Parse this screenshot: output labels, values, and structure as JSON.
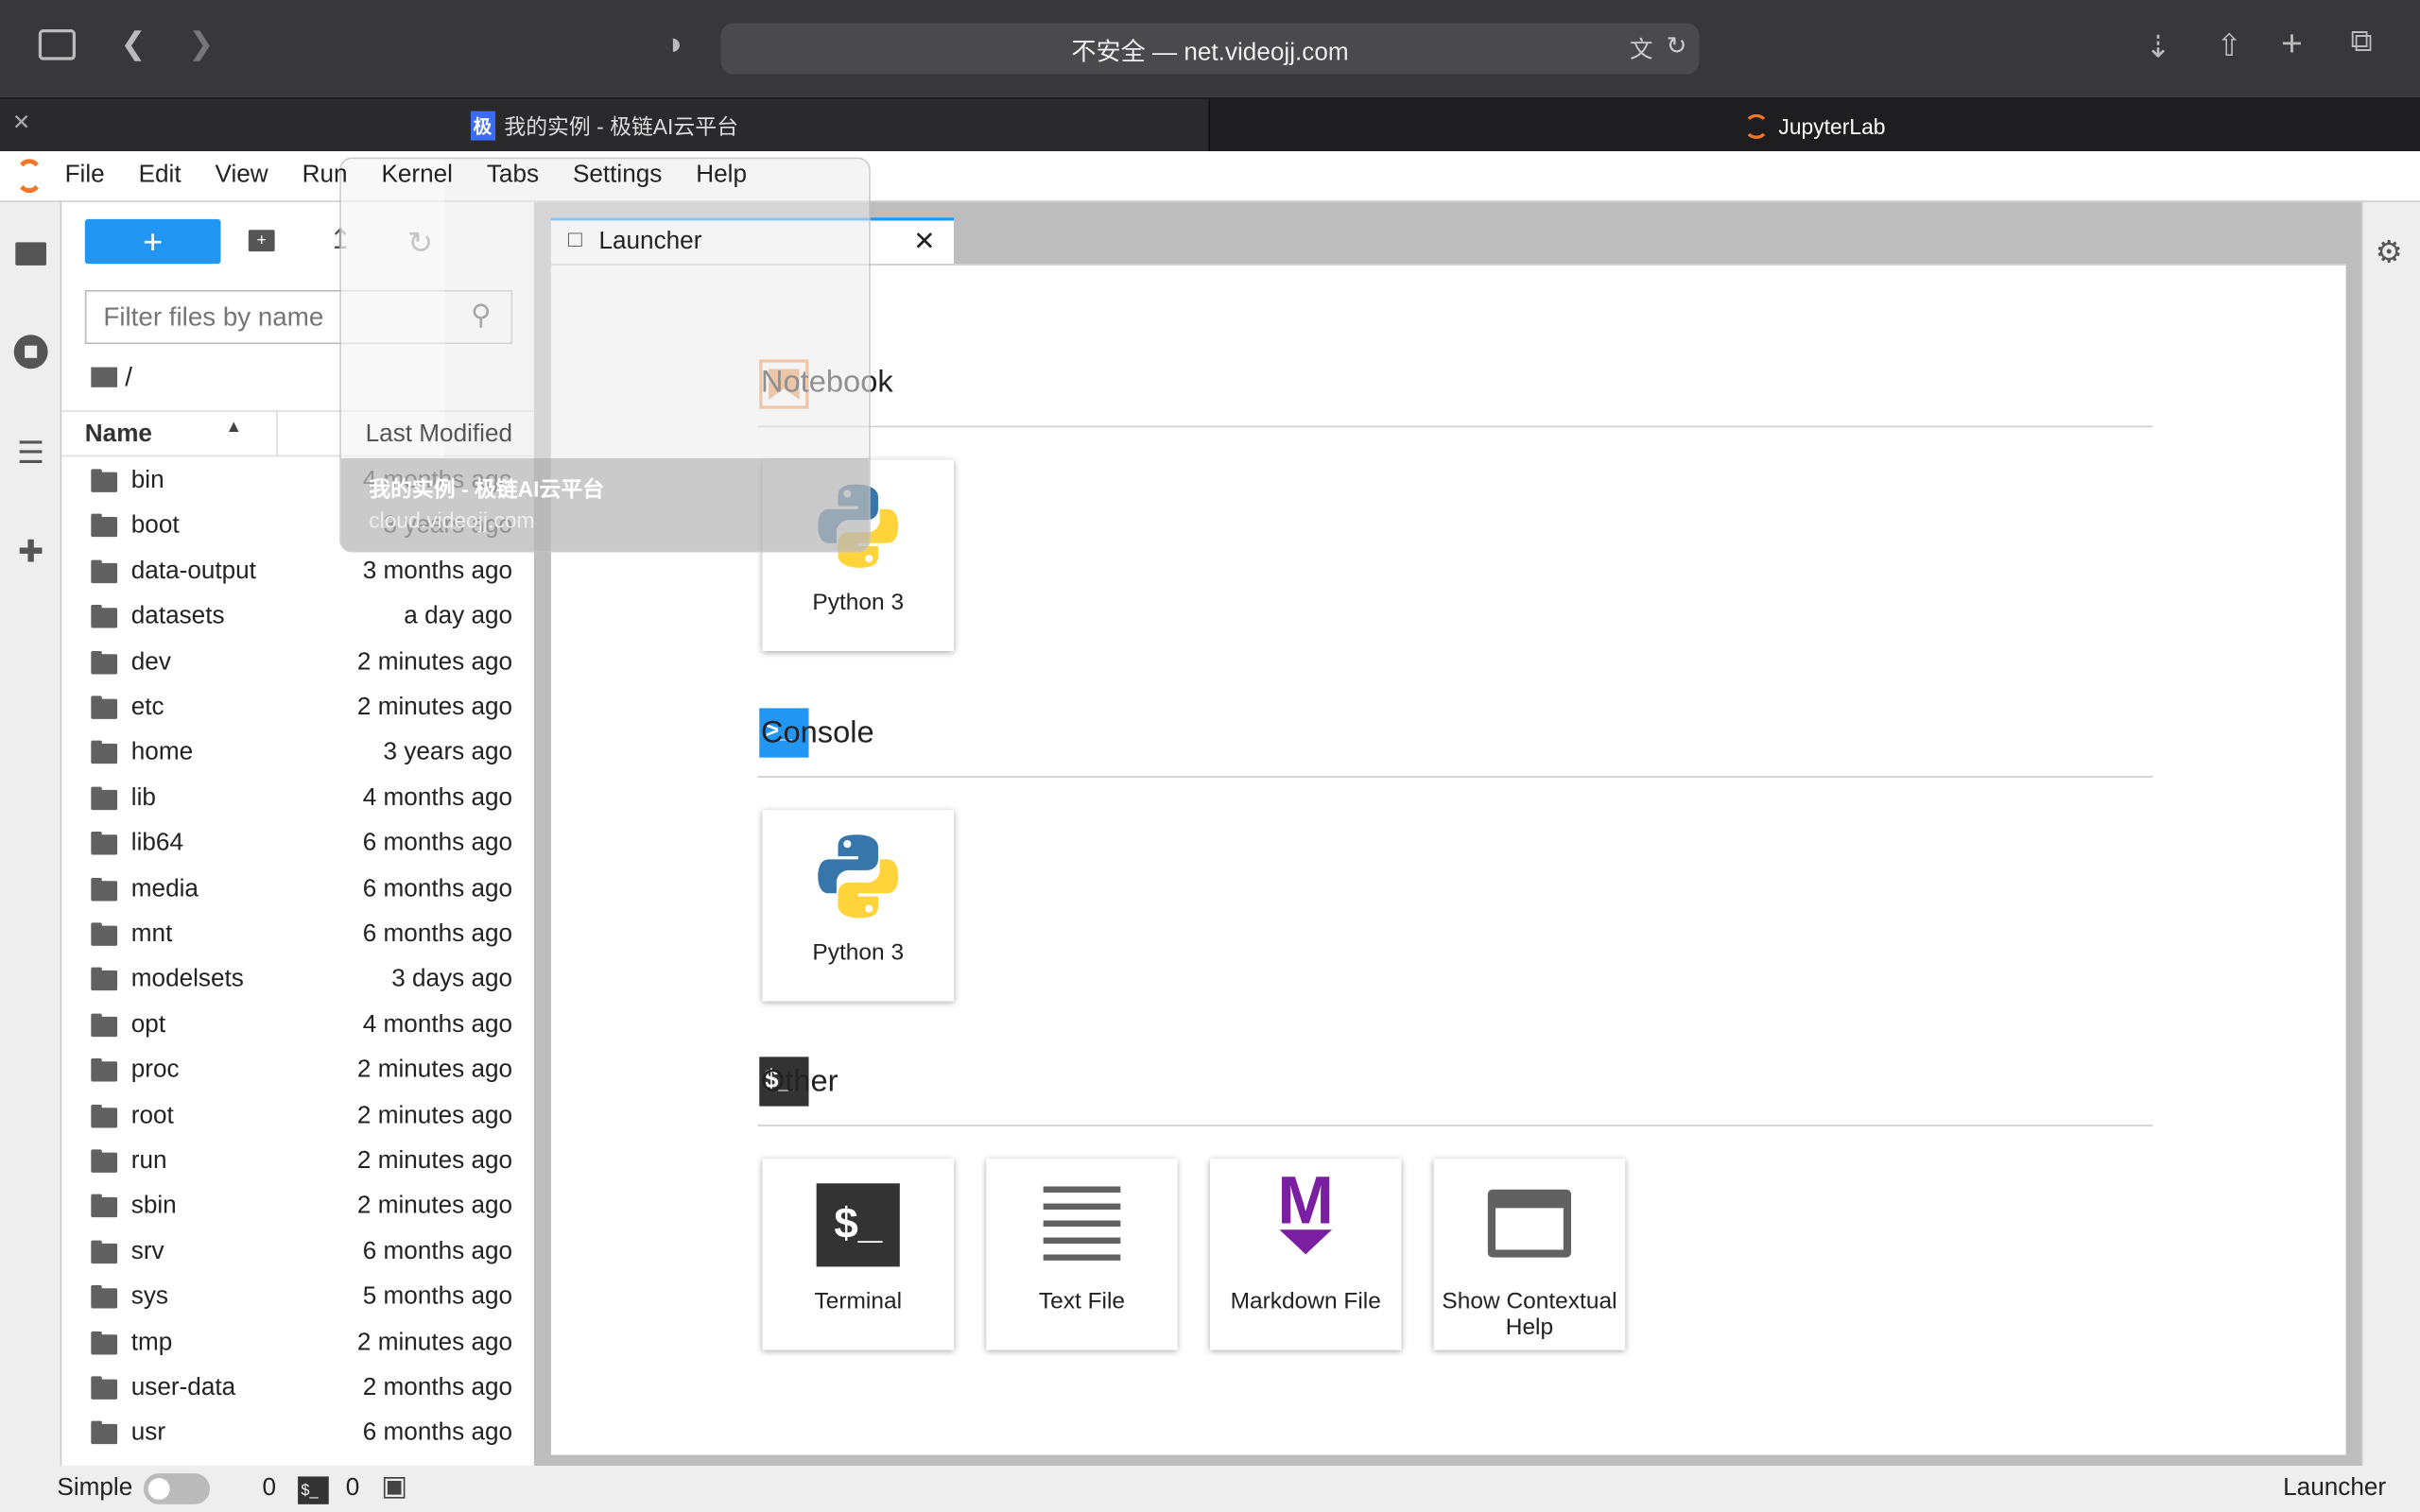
{
  "browser": {
    "url": "不安全 — net.videojj.com",
    "tabs": [
      {
        "title": "我的实例 - 极链AI云平台",
        "icon": "ji-logo-icon"
      },
      {
        "title": "JupyterLab",
        "icon": "jupyter-logo-icon"
      }
    ],
    "tab_preview": {
      "title": "我的实例 - 极链AI云平台",
      "url": "cloud.videojj.com"
    }
  },
  "menu": [
    "File",
    "Edit",
    "View",
    "Run",
    "Kernel",
    "Tabs",
    "Settings",
    "Help"
  ],
  "filebrowser": {
    "filter_placeholder": "Filter files by name",
    "path": "/",
    "col_name": "Name",
    "col_modified": "Last Modified",
    "files": [
      {
        "name": "bin",
        "modified": "4 months ago"
      },
      {
        "name": "boot",
        "modified": "3 years ago"
      },
      {
        "name": "data-output",
        "modified": "3 months ago"
      },
      {
        "name": "datasets",
        "modified": "a day ago"
      },
      {
        "name": "dev",
        "modified": "2 minutes ago"
      },
      {
        "name": "etc",
        "modified": "2 minutes ago"
      },
      {
        "name": "home",
        "modified": "3 years ago"
      },
      {
        "name": "lib",
        "modified": "4 months ago"
      },
      {
        "name": "lib64",
        "modified": "6 months ago"
      },
      {
        "name": "media",
        "modified": "6 months ago"
      },
      {
        "name": "mnt",
        "modified": "6 months ago"
      },
      {
        "name": "modelsets",
        "modified": "3 days ago"
      },
      {
        "name": "opt",
        "modified": "4 months ago"
      },
      {
        "name": "proc",
        "modified": "2 minutes ago"
      },
      {
        "name": "root",
        "modified": "2 minutes ago"
      },
      {
        "name": "run",
        "modified": "2 minutes ago"
      },
      {
        "name": "sbin",
        "modified": "2 minutes ago"
      },
      {
        "name": "srv",
        "modified": "6 months ago"
      },
      {
        "name": "sys",
        "modified": "5 months ago"
      },
      {
        "name": "tmp",
        "modified": "2 minutes ago"
      },
      {
        "name": "user-data",
        "modified": "2 months ago"
      },
      {
        "name": "usr",
        "modified": "6 months ago"
      }
    ]
  },
  "launcher": {
    "tab_label": "Launcher",
    "sections": {
      "notebook": "Notebook",
      "console": "Console",
      "other": "Other"
    },
    "cards": {
      "nb_python": "Python 3",
      "con_python": "Python 3",
      "terminal": "Terminal",
      "text": "Text File",
      "markdown": "Markdown File",
      "help": "Show Contextual Help"
    }
  },
  "status": {
    "mode": "Simple",
    "simple_on": false,
    "kernels": "0",
    "terminals": "0",
    "right": "Launcher"
  },
  "colors": {
    "accent": "#2196f3",
    "notebook": "#ef9a5a",
    "markdown": "#7b1fa2"
  }
}
